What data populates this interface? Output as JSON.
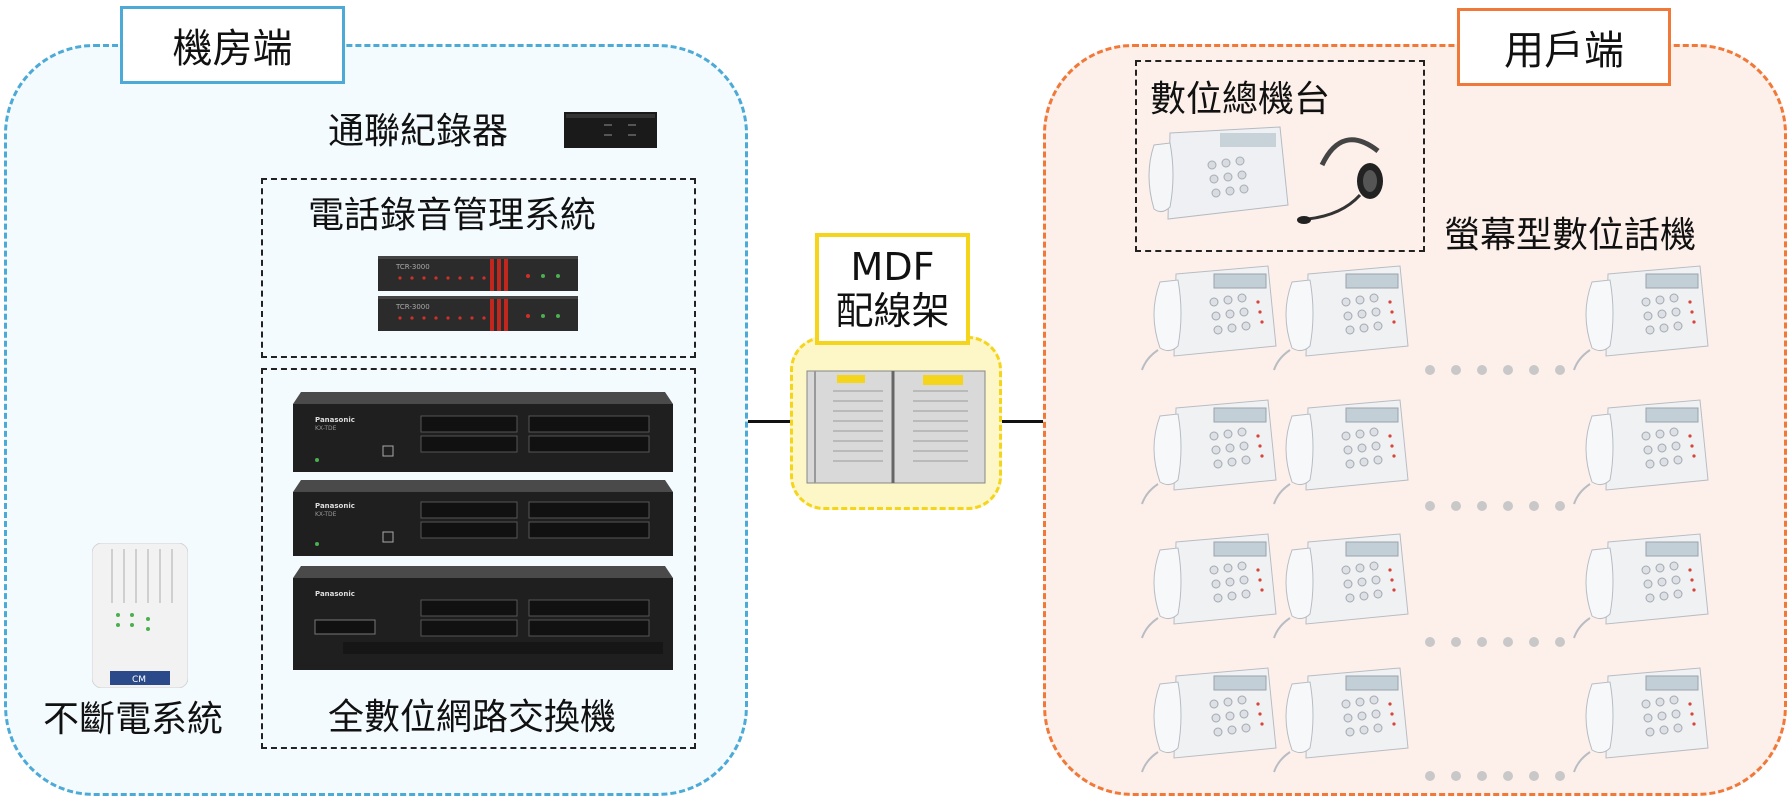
{
  "zones": {
    "left_title": "機房端",
    "right_title": "用戶端"
  },
  "equipment": {
    "call_recorder": "通聯紀錄器",
    "recording_system": "電話錄音管理系統",
    "ups": "不斷電系統",
    "pbx": "全數位網路交換機",
    "recorder_model": "TCR-3000",
    "brand": "Panasonic",
    "pbx_model": "KX-TDE",
    "ups_brand": "CM"
  },
  "mdf": {
    "title": "MDF",
    "subtitle": "配線架"
  },
  "user_side": {
    "console_label": "數位總機台",
    "phone_label": "螢幕型數位話機"
  },
  "colors": {
    "server_zone": "#4da9d6",
    "user_zone": "#f07838",
    "mdf": "#f4d51c"
  }
}
